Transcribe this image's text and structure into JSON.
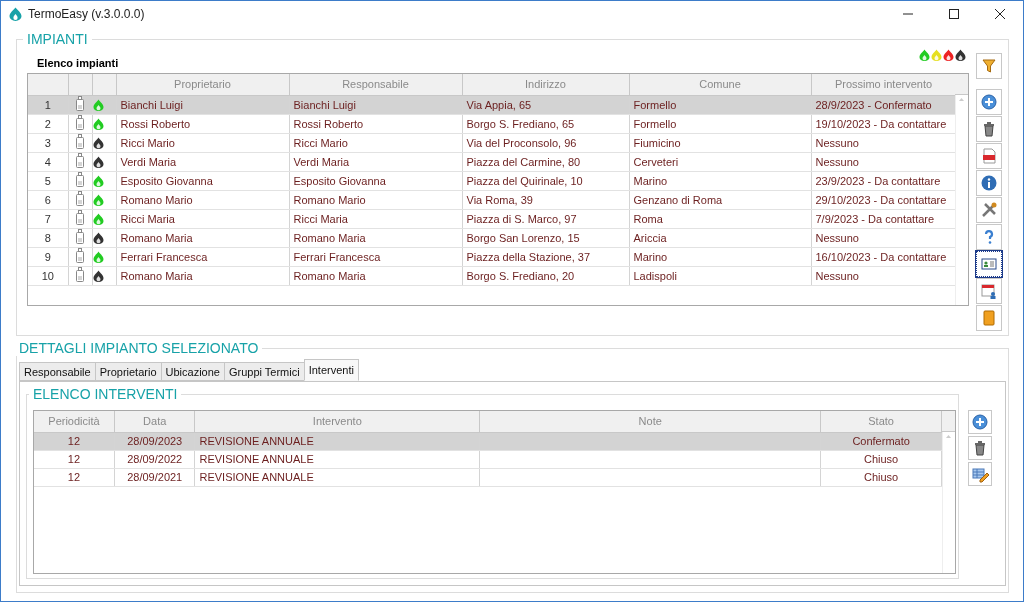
{
  "window": {
    "title": "TermoEasy (v.3.0.0.0)"
  },
  "impianti": {
    "legend": "IMPIANTI",
    "list_title": "Elenco impianti",
    "legend_flames": [
      {
        "color": "#22cc22"
      },
      {
        "color": "#e6e020"
      },
      {
        "color": "#ee2222"
      },
      {
        "color": "#333333"
      }
    ],
    "columns": [
      "Proprietario",
      "Responsabile",
      "Indirizzo",
      "Comune",
      "Prossimo intervento"
    ],
    "rows": [
      {
        "number": "1",
        "selected": true,
        "color": "#22cc22",
        "cells": [
          "Bianchi Luigi",
          "Bianchi Luigi",
          "Via Appia, 65",
          "Formello",
          "28/9/2023 - Confermato"
        ]
      },
      {
        "number": "2",
        "selected": false,
        "color": "#22cc22",
        "cells": [
          "Rossi Roberto",
          "Rossi Roberto",
          "Borgo S. Frediano, 65",
          "Formello",
          "19/10/2023 - Da contattare"
        ]
      },
      {
        "number": "3",
        "selected": false,
        "color": "#333333",
        "cells": [
          "Ricci Mario",
          "Ricci Mario",
          "Via del Proconsolo, 96",
          "Fiumicino",
          "Nessuno"
        ]
      },
      {
        "number": "4",
        "selected": false,
        "color": "#333333",
        "cells": [
          "Verdi Maria",
          "Verdi Maria",
          "Piazza del Carmine, 80",
          "Cerveteri",
          "Nessuno"
        ]
      },
      {
        "number": "5",
        "selected": false,
        "color": "#22cc22",
        "cells": [
          "Esposito Giovanna",
          "Esposito Giovanna",
          "Piazza del Quirinale, 10",
          "Marino",
          "23/9/2023 - Da contattare"
        ]
      },
      {
        "number": "6",
        "selected": false,
        "color": "#22cc22",
        "cells": [
          "Romano Mario",
          "Romano Mario",
          "Via Roma, 39",
          "Genzano di Roma",
          "29/10/2023 - Da contattare"
        ]
      },
      {
        "number": "7",
        "selected": false,
        "color": "#22cc22",
        "cells": [
          "Ricci Maria",
          "Ricci Maria",
          "Piazza di S. Marco, 97",
          "Roma",
          "7/9/2023 - Da contattare"
        ]
      },
      {
        "number": "8",
        "selected": false,
        "color": "#333333",
        "cells": [
          "Romano Maria",
          "Romano Maria",
          "Borgo San Lorenzo, 15",
          "Ariccia",
          "Nessuno"
        ]
      },
      {
        "number": "9",
        "selected": false,
        "color": "#22cc22",
        "cells": [
          "Ferrari Francesca",
          "Ferrari Francesca",
          "Piazza della Stazione, 37",
          "Marino",
          "16/10/2023 - Da contattare"
        ]
      },
      {
        "number": "10",
        "selected": false,
        "color": "#333333",
        "cells": [
          "Romano Maria",
          "Romano Maria",
          "Borgo S. Frediano, 20",
          "Ladispoli",
          "Nessuno"
        ]
      }
    ],
    "filter_button": {
      "kind": "filter"
    },
    "toolbar": [
      {
        "kind": "add",
        "focused": false
      },
      {
        "kind": "delete",
        "focused": false
      },
      {
        "kind": "pdf",
        "focused": false
      },
      {
        "kind": "info",
        "focused": false
      },
      {
        "kind": "tools",
        "focused": false
      },
      {
        "kind": "help",
        "focused": false
      },
      {
        "kind": "card",
        "focused": true
      },
      {
        "kind": "calendar",
        "focused": false
      },
      {
        "kind": "book",
        "focused": false
      }
    ]
  },
  "dettagli": {
    "legend": "DETTAGLI IMPIANTO SELEZIONATO",
    "tabs": [
      {
        "label": "Responsabile",
        "selected": false
      },
      {
        "label": "Proprietario",
        "selected": false
      },
      {
        "label": "Ubicazione",
        "selected": false
      },
      {
        "label": "Gruppi Termici",
        "selected": false
      },
      {
        "label": "Interventi",
        "selected": true
      }
    ],
    "interventi": {
      "legend": "ELENCO INTERVENTI",
      "columns": [
        "Periodicità",
        "Data",
        "Intervento",
        "Note",
        "Stato"
      ],
      "rows": [
        {
          "periodicita": "12",
          "data": "28/09/2023",
          "intervento": "REVISIONE ANNUALE",
          "stato": "Confermato",
          "selected": true
        },
        {
          "periodicita": "12",
          "data": "28/09/2022",
          "intervento": "REVISIONE ANNUALE",
          "stato": "Chiuso",
          "selected": false
        },
        {
          "periodicita": "12",
          "data": "28/09/2021",
          "intervento": "REVISIONE ANNUALE",
          "stato": "Chiuso",
          "selected": false
        }
      ],
      "toolbar": [
        {
          "kind": "add",
          "focused": false
        },
        {
          "kind": "delete",
          "focused": false
        },
        {
          "kind": "edit",
          "focused": false
        }
      ]
    }
  }
}
